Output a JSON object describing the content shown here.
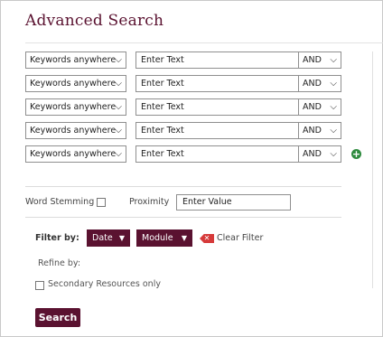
{
  "panel": {
    "title": "Advanced Search"
  },
  "rows": [
    {
      "field": "Keywords anywhere",
      "text": "Enter Text",
      "operator": "AND"
    },
    {
      "field": "Keywords anywhere",
      "text": "Enter Text",
      "operator": "AND"
    },
    {
      "field": "Keywords anywhere",
      "text": "Enter Text",
      "operator": "AND"
    },
    {
      "field": "Keywords anywhere",
      "text": "Enter Text",
      "operator": "AND"
    },
    {
      "field": "Keywords anywhere",
      "text": "Enter Text",
      "operator": "AND"
    }
  ],
  "options": {
    "word_stemming_label": "Word Stemming",
    "proximity_label": "Proximity",
    "proximity_value": "Enter Value"
  },
  "filter": {
    "label": "Filter by:",
    "date_label": "Date",
    "module_label": "Module",
    "clear_label": "Clear Filter",
    "refine_label": "Refine by:",
    "secondary_label": "Secondary Resources only"
  },
  "actions": {
    "search_label": "Search"
  },
  "colors": {
    "accent": "#5a1230",
    "add": "#2e8b3e",
    "clear": "#d63a3a"
  },
  "icons": {
    "select": "chevron-down-icon",
    "add": "plus-circle-icon",
    "clear": "clear-x-icon",
    "caret": "caret-down-icon"
  }
}
